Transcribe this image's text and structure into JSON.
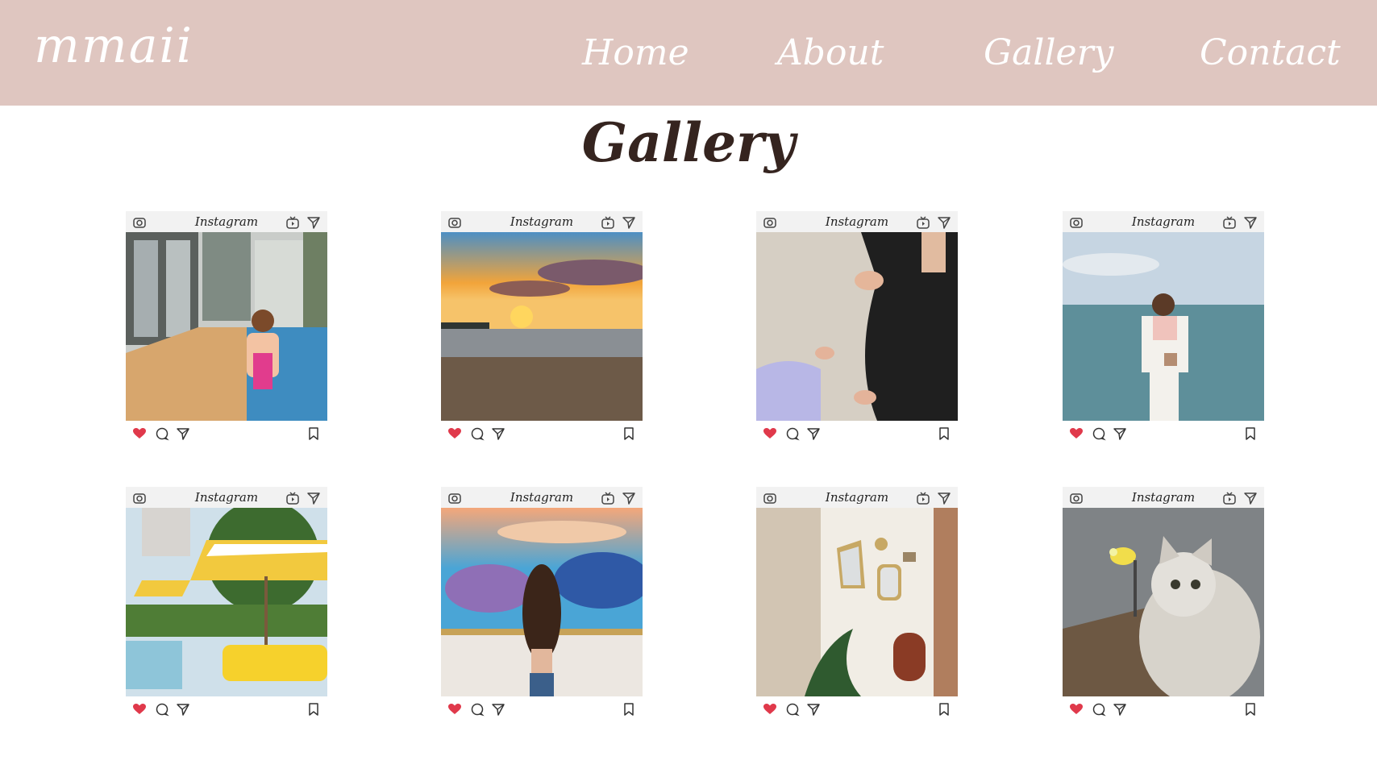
{
  "nav": {
    "logo": "mmaii",
    "links": [
      "Home",
      "About",
      "Gallery",
      "Contact"
    ]
  },
  "page": {
    "title": "Gallery"
  },
  "card_brand": "Instagram",
  "colors": {
    "nav_bg": "#dfc6c0",
    "heart": "#e0394b",
    "title": "#35241f"
  },
  "icons": {
    "top": [
      "camera-icon",
      "igtv-icon",
      "send-icon"
    ],
    "actions": [
      "heart-icon",
      "comment-icon",
      "send-icon",
      "bookmark-icon"
    ]
  },
  "posts": [
    {
      "subject": "pool villa"
    },
    {
      "subject": "beach sunset"
    },
    {
      "subject": "feet on sand"
    },
    {
      "subject": "seaside pose"
    },
    {
      "subject": "garden umbrellas"
    },
    {
      "subject": "sky painting"
    },
    {
      "subject": "mirror wall"
    },
    {
      "subject": "grey cat"
    }
  ]
}
